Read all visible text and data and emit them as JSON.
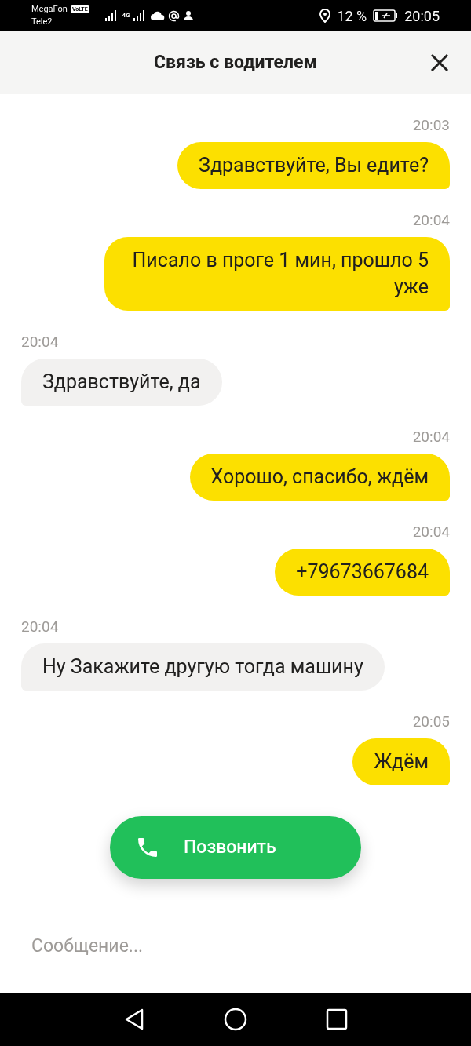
{
  "status_bar": {
    "carrier_1": "MegaFon",
    "volte_badge": "VoLTE",
    "carrier_2": "Tele2",
    "network_badge": "4G",
    "battery": "12 %",
    "time": "20:05"
  },
  "header": {
    "title": "Связь с водителем"
  },
  "messages": [
    {
      "kind": "outgoing",
      "time": "20:03",
      "text": "Здравствуйте, Вы едите?"
    },
    {
      "kind": "outgoing",
      "time": "20:04",
      "text": "Писало в проге 1 мин, прошло 5 уже"
    },
    {
      "kind": "incoming",
      "time": "20:04",
      "text": "Здравствуйте, да"
    },
    {
      "kind": "outgoing",
      "time": "20:04",
      "text": "Хорошо, спасибо, ждём"
    },
    {
      "kind": "outgoing",
      "time": "20:04",
      "text": "+79673667684"
    },
    {
      "kind": "incoming",
      "time": "20:04",
      "text": "Ну Закажите другую тогда машину"
    },
    {
      "kind": "outgoing",
      "time": "20:05",
      "text": "Ждём"
    }
  ],
  "call_button": {
    "label": "Позвонить"
  },
  "message_field": {
    "placeholder": "Сообщение..."
  }
}
